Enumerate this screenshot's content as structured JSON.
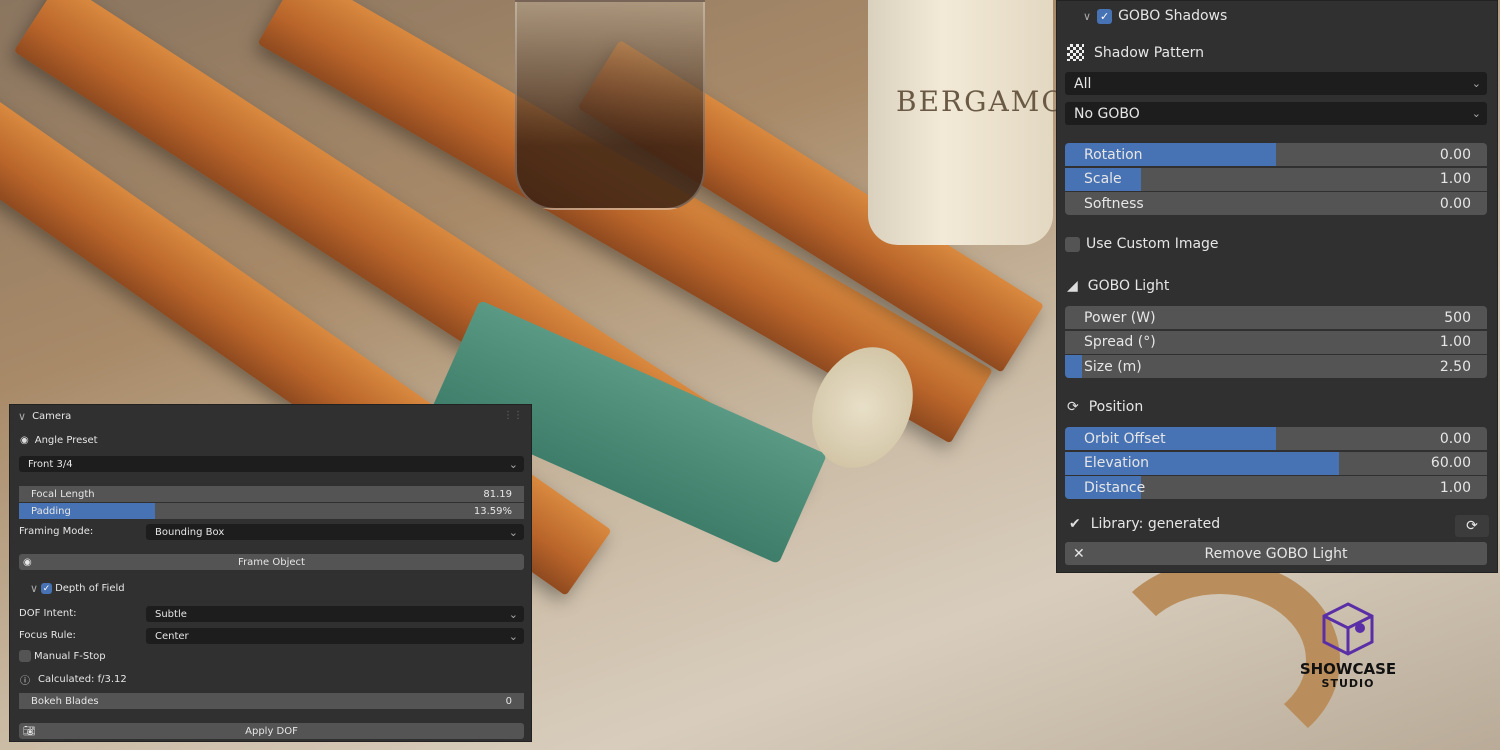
{
  "scene": {
    "candle_label": "BERGAMOT"
  },
  "gobo": {
    "header": "GOBO Shadows",
    "enabled": true,
    "shadow_pattern_label": "Shadow Pattern",
    "pattern_filter": "All",
    "pattern_select": "No GOBO",
    "sliders": [
      {
        "label": "Rotation",
        "value": "0.00",
        "fill": 0.5
      },
      {
        "label": "Scale",
        "value": "1.00",
        "fill": 0.18
      },
      {
        "label": "Softness",
        "value": "0.00",
        "fill": 0
      }
    ],
    "use_custom_image": "Use Custom Image",
    "use_custom_image_checked": false,
    "light_label": "GOBO Light",
    "light_sliders": [
      {
        "label": "Power (W)",
        "value": "500",
        "fill": 0
      },
      {
        "label": "Spread (°)",
        "value": "1.00",
        "fill": 0
      },
      {
        "label": "Size (m)",
        "value": "2.50",
        "fill": 0.04
      }
    ],
    "position_label": "Position",
    "position_sliders": [
      {
        "label": "Orbit Offset",
        "value": "0.00",
        "fill": 0.5
      },
      {
        "label": "Elevation",
        "value": "60.00",
        "fill": 0.65
      },
      {
        "label": "Distance",
        "value": "1.00",
        "fill": 0.18
      }
    ],
    "library_status": "Library: generated",
    "remove_button": "Remove GOBO Light"
  },
  "camera": {
    "header": "Camera",
    "angle_preset_label": "Angle Preset",
    "angle_preset": "Front 3/4",
    "focal_length_label": "Focal Length",
    "focal_length": "81.19",
    "padding_label": "Padding",
    "padding": "13.59%",
    "padding_fill": 0.27,
    "framing_mode_label": "Framing Mode:",
    "framing_mode": "Bounding Box",
    "frame_object_button": "Frame Object",
    "dof_header": "Depth of Field",
    "dof_enabled": true,
    "dof_intent_label": "DOF Intent:",
    "dof_intent": "Subtle",
    "focus_rule_label": "Focus Rule:",
    "focus_rule": "Center",
    "manual_fstop_label": "Manual F-Stop",
    "manual_fstop_checked": false,
    "calculated": "Calculated: f/3.12",
    "bokeh_blades_label": "Bokeh Blades",
    "bokeh_blades": "0",
    "apply_dof_button": "Apply DOF"
  },
  "logo": {
    "line1": "SHOWCASE",
    "line2": "STUDIO"
  },
  "colors": {
    "accent": "#4772b3",
    "panel": "#303030",
    "field": "#545454",
    "dropdown": "#1d1d1d"
  }
}
